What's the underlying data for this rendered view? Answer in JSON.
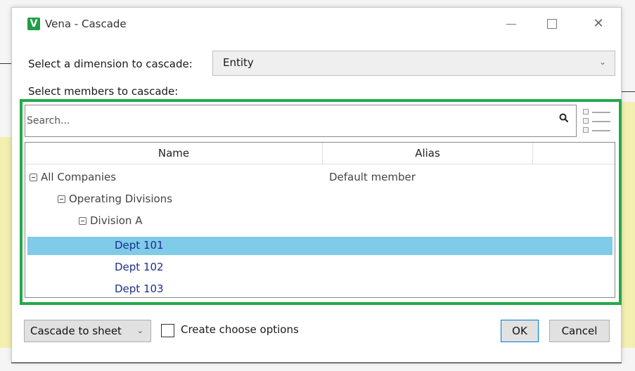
{
  "window": {
    "title": "Vena - Cascade",
    "logo_glyph": "V",
    "close_glyph": "✕"
  },
  "dimension": {
    "label": "Select a dimension to cascade:",
    "selected": "Entity"
  },
  "members": {
    "label": "Select members to cascade:",
    "search_placeholder": "Search...",
    "columns": {
      "name": "Name",
      "alias": "Alias"
    },
    "rows": [
      {
        "name": "All Companies",
        "alias": "Default member",
        "level": 0,
        "expandable": true,
        "selected": false
      },
      {
        "name": "Operating Divisions",
        "alias": "",
        "level": 1,
        "expandable": true,
        "selected": false
      },
      {
        "name": "Division A",
        "alias": "",
        "level": 2,
        "expandable": true,
        "selected": false
      },
      {
        "name": "Dept 101",
        "alias": "",
        "level": 3,
        "expandable": false,
        "selected": true
      },
      {
        "name": "Dept 102",
        "alias": "",
        "level": 3,
        "expandable": false,
        "selected": false
      },
      {
        "name": "Dept 103",
        "alias": "",
        "level": 3,
        "expandable": false,
        "selected": false
      }
    ]
  },
  "footer": {
    "cascade_button": "Cascade to sheet",
    "create_options_label": "Create choose options",
    "create_options_checked": false,
    "ok_label": "OK",
    "cancel_label": "Cancel"
  },
  "colors": {
    "highlight_border": "#23a94a",
    "selected_row": "#7fcbe8",
    "leaf_text": "#1c2f8a",
    "logo": "#1e9e46"
  }
}
